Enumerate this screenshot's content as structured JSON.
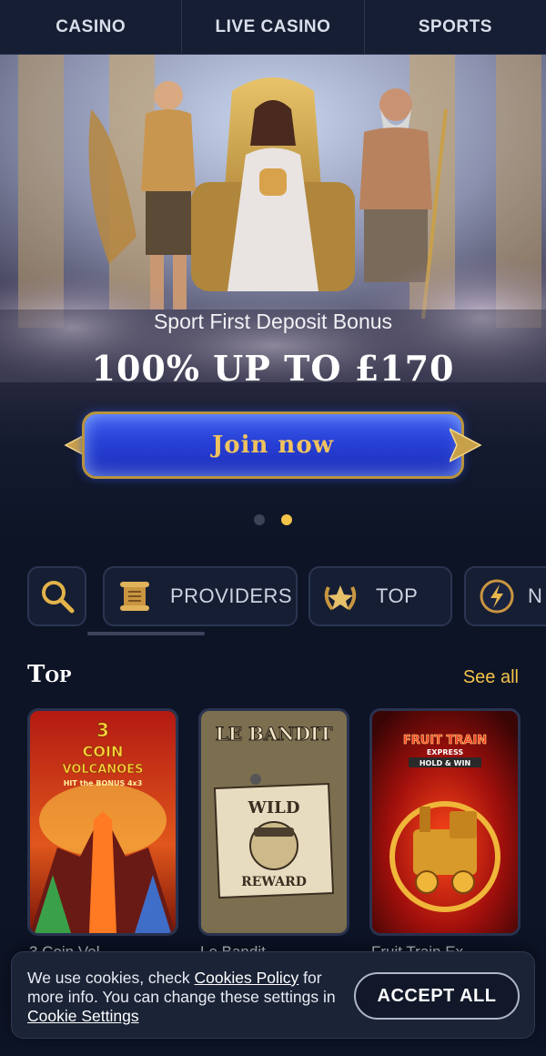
{
  "topnav": {
    "tabs": [
      {
        "label": "CASINO"
      },
      {
        "label": "LIVE CASINO"
      },
      {
        "label": "SPORTS"
      }
    ]
  },
  "hero": {
    "subtitle": "Sport First Deposit Bonus",
    "headline": "100% UP TO £170",
    "cta_label": "Join now",
    "slides": {
      "count": 2,
      "active": 2
    }
  },
  "categories": [
    {
      "label": "",
      "icon": "search-icon"
    },
    {
      "label": "PROVIDERS",
      "icon": "scroll-icon"
    },
    {
      "label": "TOP",
      "icon": "laurel-star-icon"
    },
    {
      "label": "N",
      "icon": "lightning-icon"
    }
  ],
  "section": {
    "title": "Top",
    "see_all": "See all"
  },
  "games": [
    {
      "title_art": "3 COIN VOLCANOES",
      "sub_art": "HIT the BONUS 4x3",
      "name": "3 Coin Vol"
    },
    {
      "title_art": "LE BANDIT",
      "sub_art": "WILD REWARD",
      "name": "Le Bandit"
    },
    {
      "title_art": "FRUIT TRAIN EXPRESS",
      "sub_art": "HOLD & WIN",
      "name": "Fruit Train Ex"
    }
  ],
  "cookie": {
    "text_1": "We use cookies, check ",
    "link_1": "Cookies Policy",
    "text_2": " for more info. You can change these settings in ",
    "link_2": "Cookie Settings",
    "accept_label": "ACCEPT ALL"
  },
  "colors": {
    "background": "#0d1426",
    "accent_gold": "#f3c34a",
    "cta_blue": "#2740d6"
  }
}
